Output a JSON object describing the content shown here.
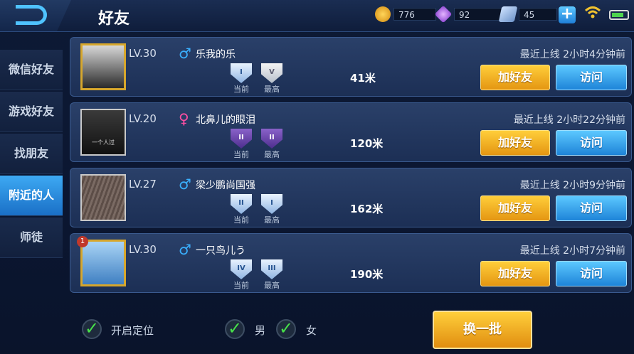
{
  "header": {
    "title": "好友",
    "gold": "776",
    "diamond": "92",
    "voucher": "45",
    "plus_label": "+"
  },
  "sidebar": {
    "items": [
      {
        "label": "微信好友"
      },
      {
        "label": "游戏好友"
      },
      {
        "label": "找朋友"
      },
      {
        "label": "附近的人"
      },
      {
        "label": "师徒"
      }
    ],
    "active_index": 3
  },
  "rank_captions": {
    "current": "当前",
    "highest": "最高"
  },
  "buttons": {
    "add": "加好友",
    "visit": "访问",
    "refresh": "换一批"
  },
  "last_online_label": "最近上线",
  "players": [
    {
      "level": "LV.30",
      "gender": "male",
      "gender_symbol": "♂",
      "name": "乐我的乐",
      "rank_current": "I",
      "rank_highest": "V",
      "distance": "41米",
      "last_online": "2小时4分钟前"
    },
    {
      "level": "LV.20",
      "gender": "female",
      "gender_symbol": "♀",
      "name": "北鼻儿的眼泪",
      "rank_current": "II",
      "rank_highest": "II",
      "distance": "120米",
      "last_online": "2小时22分钟前"
    },
    {
      "level": "LV.27",
      "gender": "male",
      "gender_symbol": "♂",
      "name": "梁少鹏尚国强",
      "rank_current": "II",
      "rank_highest": "I",
      "distance": "162米",
      "last_online": "2小时9分钟前"
    },
    {
      "level": "LV.30",
      "gender": "male",
      "gender_symbol": "♂",
      "name": "一只鸟儿う",
      "rank_current": "IV",
      "rank_highest": "III",
      "distance": "190米",
      "last_online": "2小时7分钟前"
    }
  ],
  "filters": {
    "location": "开启定位",
    "male": "男",
    "female": "女",
    "location_checked": true,
    "male_checked": true,
    "female_checked": true
  },
  "avatar_text": {
    "row2": "一个人过"
  },
  "avatar_badge": {
    "row4": "1"
  }
}
